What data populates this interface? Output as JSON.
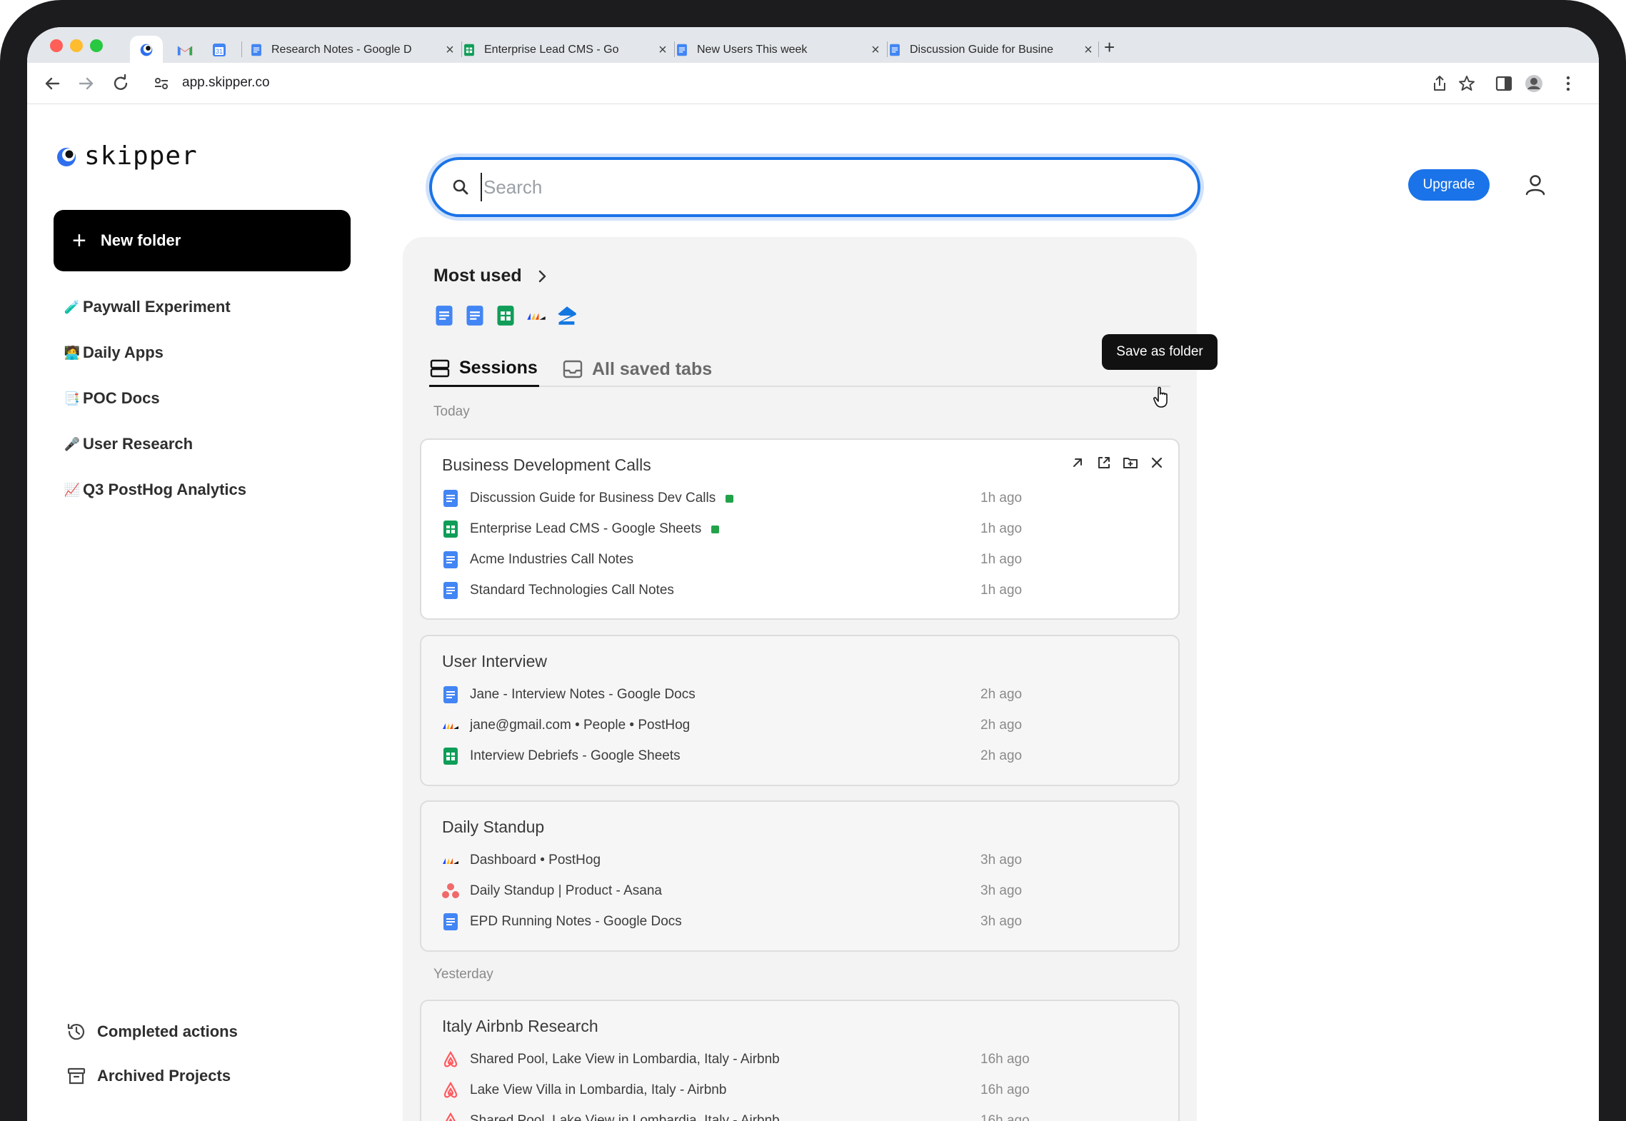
{
  "browser": {
    "tabs": [
      {
        "title": "",
        "icon": "skipper-icon",
        "active": true
      },
      {
        "title": "",
        "icon": "gmail-icon"
      },
      {
        "title": "",
        "icon": "google-calendar-icon"
      },
      {
        "title": "Research Notes - Google D",
        "icon": "google-docs-icon"
      },
      {
        "title": "Enterprise Lead CMS - Go",
        "icon": "google-sheets-icon"
      },
      {
        "title": "New Users This week",
        "icon": "google-docs-icon"
      },
      {
        "title": "Discussion Guide for Busine",
        "icon": "google-docs-icon"
      }
    ],
    "new_tab_label": "+",
    "url": "app.skipper.co"
  },
  "app": {
    "logo_text": "skipper",
    "new_folder_label": "New folder",
    "folders": [
      {
        "emoji": "🧪",
        "label": "Paywall Experiment"
      },
      {
        "emoji": "🧑‍💻",
        "label": "Daily Apps"
      },
      {
        "emoji": "📑",
        "label": "POC Docs"
      },
      {
        "emoji": "🎤",
        "label": "User Research"
      },
      {
        "emoji": "📈",
        "label": "Q3 PostHog Analytics"
      }
    ],
    "bottom_nav": [
      {
        "icon": "history-icon",
        "label": "Completed actions"
      },
      {
        "icon": "archive-icon",
        "label": "Archived Projects"
      }
    ],
    "search": {
      "placeholder": "Search",
      "value": ""
    },
    "upgrade_label": "Upgrade",
    "most_used": {
      "title": "Most used",
      "icons": [
        "google-docs-icon",
        "google-docs-icon",
        "google-sheets-icon",
        "posthog-icon",
        "zillow-icon"
      ]
    },
    "view_tabs": [
      {
        "label": "Sessions",
        "icon": "sessions-icon",
        "active": true
      },
      {
        "label": "All saved tabs",
        "icon": "inbox-icon",
        "active": false
      }
    ],
    "tooltip": "Save as folder",
    "days": [
      {
        "label": "Today",
        "sessions": [
          {
            "title": "Business Development Calls",
            "items": [
              {
                "icon": "google-docs-icon",
                "title": "Discussion Guide for Business Dev Calls",
                "open": true,
                "time": "1h ago"
              },
              {
                "icon": "google-sheets-icon",
                "title": "Enterprise Lead CMS - Google Sheets",
                "open": true,
                "time": "1h ago"
              },
              {
                "icon": "google-docs-icon",
                "title": "Acme Industries Call Notes",
                "open": false,
                "time": "1h ago"
              },
              {
                "icon": "google-docs-icon",
                "title": "Standard Technologies Call Notes",
                "open": false,
                "time": "1h ago"
              }
            ]
          },
          {
            "title": "User Interview",
            "items": [
              {
                "icon": "google-docs-icon",
                "title": "Jane - Interview Notes - Google Docs",
                "time": "2h ago"
              },
              {
                "icon": "posthog-icon",
                "title": "jane@gmail.com • People • PostHog",
                "time": "2h ago"
              },
              {
                "icon": "google-sheets-icon",
                "title": "Interview Debriefs - Google Sheets",
                "time": "2h ago"
              }
            ]
          },
          {
            "title": "Daily Standup",
            "items": [
              {
                "icon": "posthog-icon",
                "title": "Dashboard • PostHog",
                "time": "3h ago"
              },
              {
                "icon": "asana-icon",
                "title": "Daily Standup | Product - Asana",
                "time": "3h ago"
              },
              {
                "icon": "google-docs-icon",
                "title": "EPD Running Notes - Google Docs",
                "time": "3h ago"
              }
            ]
          }
        ]
      },
      {
        "label": "Yesterday",
        "sessions": [
          {
            "title": "Italy Airbnb Research",
            "items": [
              {
                "icon": "airbnb-icon",
                "title": "Shared Pool, Lake View in Lombardia, Italy - Airbnb",
                "time": "16h ago"
              },
              {
                "icon": "airbnb-icon",
                "title": "Lake View Villa in Lombardia, Italy - Airbnb",
                "time": "16h ago"
              },
              {
                "icon": "airbnb-icon",
                "title": "Shared Pool, Lake View in Lombardia, Italy - Airbnb",
                "time": "16h ago"
              }
            ]
          }
        ]
      }
    ]
  }
}
